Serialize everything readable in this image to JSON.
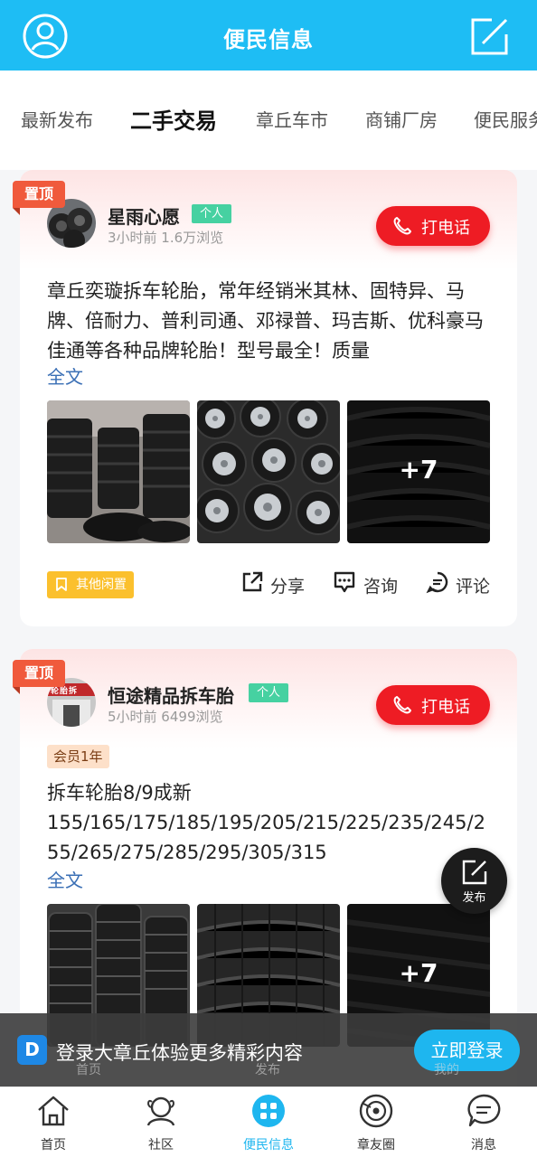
{
  "header": {
    "title": "便民信息",
    "avatar_icon": "user-circle-icon",
    "compose_icon": "compose-icon",
    "bg_color": "#1ebdf4"
  },
  "tabs": [
    {
      "label": "最新发布",
      "active": false
    },
    {
      "label": "二手交易",
      "active": true
    },
    {
      "label": "章丘车市",
      "active": false
    },
    {
      "label": "商铺厂房",
      "active": false
    },
    {
      "label": "便民服务",
      "active": false
    }
  ],
  "posts": [
    {
      "pin_label": "置顶",
      "author": "星雨心愿",
      "author_tag": "个人",
      "meta": "3小时前   1.6万浏览",
      "call_label": "打电话",
      "text": "章丘奕璇拆车轮胎，常年经销米其林、固特异、马牌、倍耐力、普利司通、邓禄普、玛吉斯、优科豪马佳通等各种品牌轮胎！型号最全！质量",
      "fulltext_label": "全文",
      "more_photos": "+7",
      "category": "其他闲置",
      "actions": {
        "share": "分享",
        "consult": "咨询",
        "comment": "评论"
      }
    },
    {
      "pin_label": "置顶",
      "author": "恒途精品拆车胎",
      "author_tag": "个人",
      "meta": "5小时前   6499浏览",
      "call_label": "打电话",
      "member_badge": "会员1年",
      "text": "拆车轮胎8/9成新\n155/165/175/185/195/205/215/225/235/245/255/265/275/285/295/305/315",
      "fulltext_label": "全文",
      "more_photos": "+7",
      "avatar_sign": "轮胎拆"
    }
  ],
  "fab": {
    "label": "发布",
    "icon": "edit-icon"
  },
  "login_banner": {
    "logo_text": "D",
    "message": "登录大章丘体验更多精彩内容",
    "button": "立即登录",
    "ghost_labels": [
      "首页",
      "发布",
      "我的"
    ]
  },
  "bottom_nav": [
    {
      "label": "首页",
      "icon": "home-icon",
      "active": false
    },
    {
      "label": "社区",
      "icon": "community-icon",
      "active": false
    },
    {
      "label": "便民信息",
      "icon": "grid-icon",
      "active": true
    },
    {
      "label": "章友圈",
      "icon": "circle-icon",
      "active": false
    },
    {
      "label": "消息",
      "icon": "message-icon",
      "active": false
    }
  ],
  "colors": {
    "accent": "#1eb6ef",
    "call": "#ee1c24",
    "pin": "#f05a3c",
    "category": "#fbc02d",
    "tag": "#46d1a1"
  }
}
